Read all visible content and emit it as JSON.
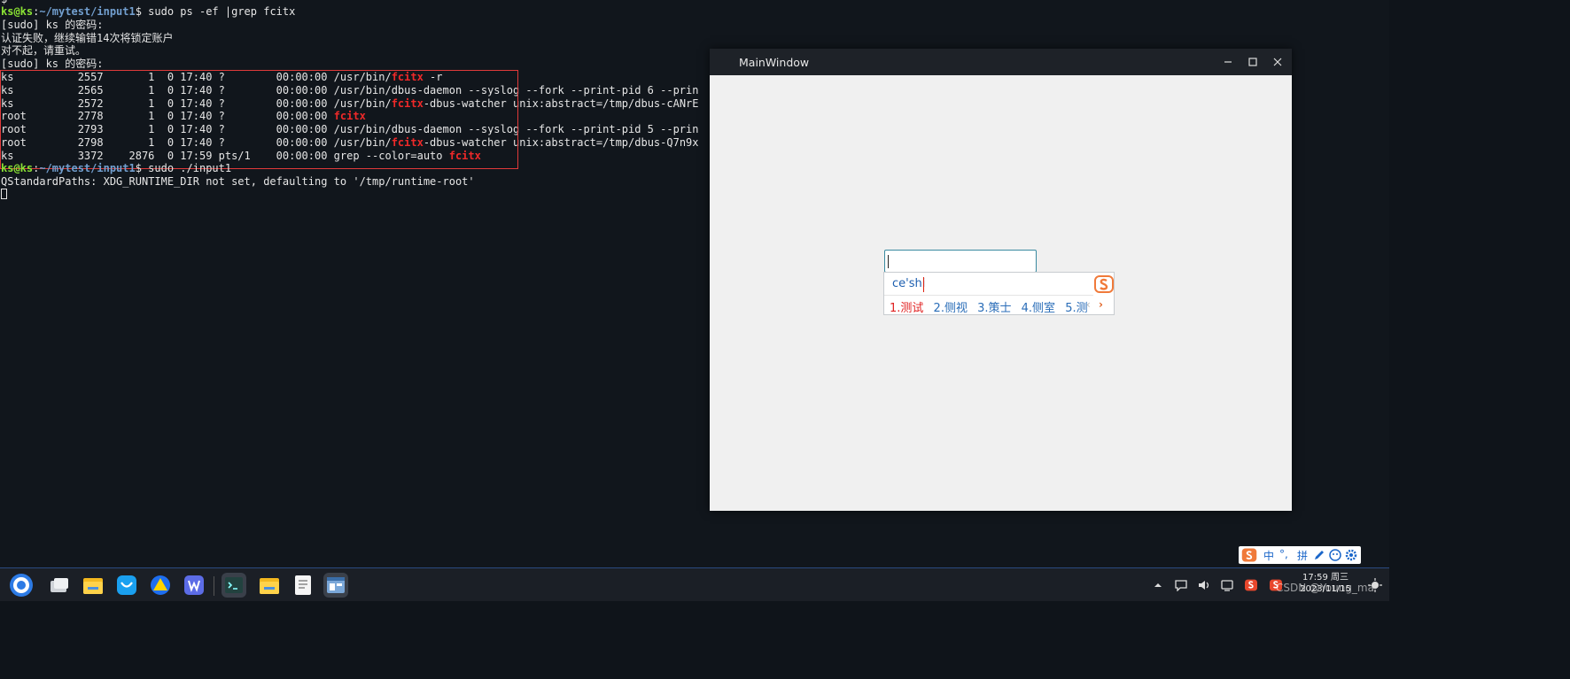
{
  "terminal": {
    "line0": "$",
    "prompt1": {
      "user": "ks@ks",
      "path": "~/mytest/input1",
      "cmd": "$ sudo ps -ef |grep fcitx"
    },
    "line2": "[sudo] ks 的密码:",
    "line3": "认证失败，继续输错14次将锁定账户",
    "line4": "对不起，请重试。",
    "line5": "[sudo] ks 的密码:",
    "ps_rows": [
      {
        "pre": "ks          2557       1  0 17:40 ?        00:00:00 /usr/bin/",
        "hl": "fcitx",
        "post": " -r"
      },
      {
        "pre": "ks          2565       1  0 17:40 ?        00:00:00 /usr/bin/dbus-daemon --syslog --fork --print-pid 6 --prin",
        "hl": "",
        "post": ""
      },
      {
        "pre": "ks          2572       1  0 17:40 ?        00:00:00 /usr/bin/",
        "hl": "fcitx",
        "post": "-dbus-watcher unix:abstract=/tmp/dbus-cANrE"
      },
      {
        "pre": "root        2778       1  0 17:40 ?        00:00:00 ",
        "hl": "fcitx",
        "post": ""
      },
      {
        "pre": "root        2793       1  0 17:40 ?        00:00:00 /usr/bin/dbus-daemon --syslog --fork --print-pid 5 --prin",
        "hl": "",
        "post": ""
      },
      {
        "pre": "root        2798       1  0 17:40 ?        00:00:00 /usr/bin/",
        "hl": "fcitx",
        "post": "-dbus-watcher unix:abstract=/tmp/dbus-Q7n9x"
      },
      {
        "pre": "ks          3372    2876  0 17:59 pts/1    00:00:00 grep --color=auto ",
        "hl": "fcitx",
        "post": ""
      }
    ],
    "prompt2": {
      "user": "ks@ks",
      "path": "~/mytest/input1",
      "cmd": "$ sudo ./input1"
    },
    "warning": "QStandardPaths: XDG_RUNTIME_DIR not set, defaulting to '/tmp/runtime-root'"
  },
  "window": {
    "title": "MainWindow"
  },
  "ime": {
    "preedit": "ce'shi",
    "candidates": [
      "1.测试",
      "2.侧视",
      "3.策士",
      "4.侧室",
      "5.测"
    ],
    "prev": "‹",
    "next": "›"
  },
  "ime_toolbar": {
    "lang": "中",
    "punct": "°,",
    "mode": "拼"
  },
  "taskbar": {
    "clock_time": "17:59 周三",
    "clock_date": "2023/11/15",
    "watermark": "CSDN @Young_ma"
  },
  "colors": {
    "highlight": "#ef2929",
    "prompt_user": "#8ae234",
    "prompt_path": "#729fcf",
    "candidate": "#2a6db8",
    "candidate_first": "#e02020"
  }
}
